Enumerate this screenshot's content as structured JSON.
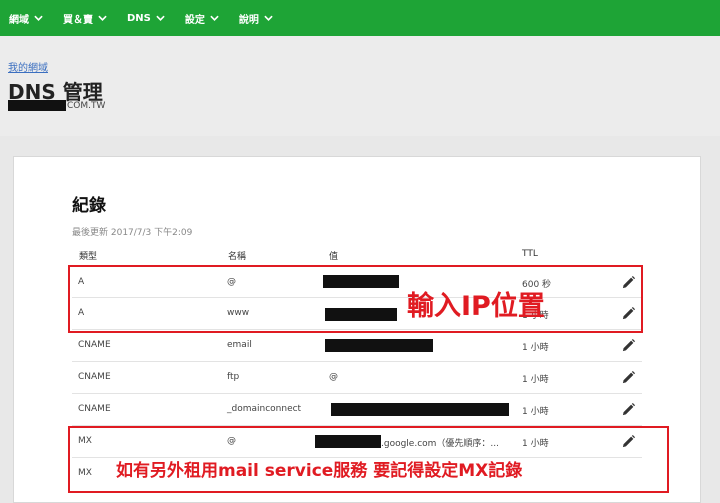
{
  "nav": {
    "items": [
      {
        "label": "網域"
      },
      {
        "label": "買＆賣"
      },
      {
        "label": "DNS"
      },
      {
        "label": "設定"
      },
      {
        "label": "說明"
      }
    ]
  },
  "header": {
    "breadcrumb": "我的網域",
    "title": "DNS 管理",
    "domain_suffix": "COM.TW"
  },
  "records": {
    "title": "紀錄",
    "last_updated": "最後更新 2017/7/3 下午2:09",
    "columns": {
      "type": "類型",
      "name": "名稱",
      "value": "值",
      "ttl": "TTL"
    },
    "rows": [
      {
        "type": "A",
        "name": "@",
        "value": "",
        "ttl": "600 秒"
      },
      {
        "type": "A",
        "name": "www",
        "value": "",
        "ttl": "1 小時"
      },
      {
        "type": "CNAME",
        "name": "email",
        "value": "",
        "ttl": "1 小時"
      },
      {
        "type": "CNAME",
        "name": "ftp",
        "value": "@",
        "ttl": "1 小時"
      },
      {
        "type": "CNAME",
        "name": "_domainconnect",
        "value": "",
        "ttl": "1 小時"
      },
      {
        "type": "MX",
        "name": "@",
        "value": ".google.com（優先順序：...",
        "ttl": "1 小時"
      },
      {
        "type": "MX",
        "name": "",
        "value": "",
        "ttl": ""
      }
    ]
  },
  "annotations": {
    "ip": "輸入IP位置",
    "mx": "如有另外租用mail service服務 要記得設定MX記錄"
  },
  "colors": {
    "nav_green": "#1ea436",
    "annotation_red": "#e01b22"
  },
  "icons": {
    "edit": "pencil-icon",
    "nav_chevron": "chevron-down-icon"
  }
}
